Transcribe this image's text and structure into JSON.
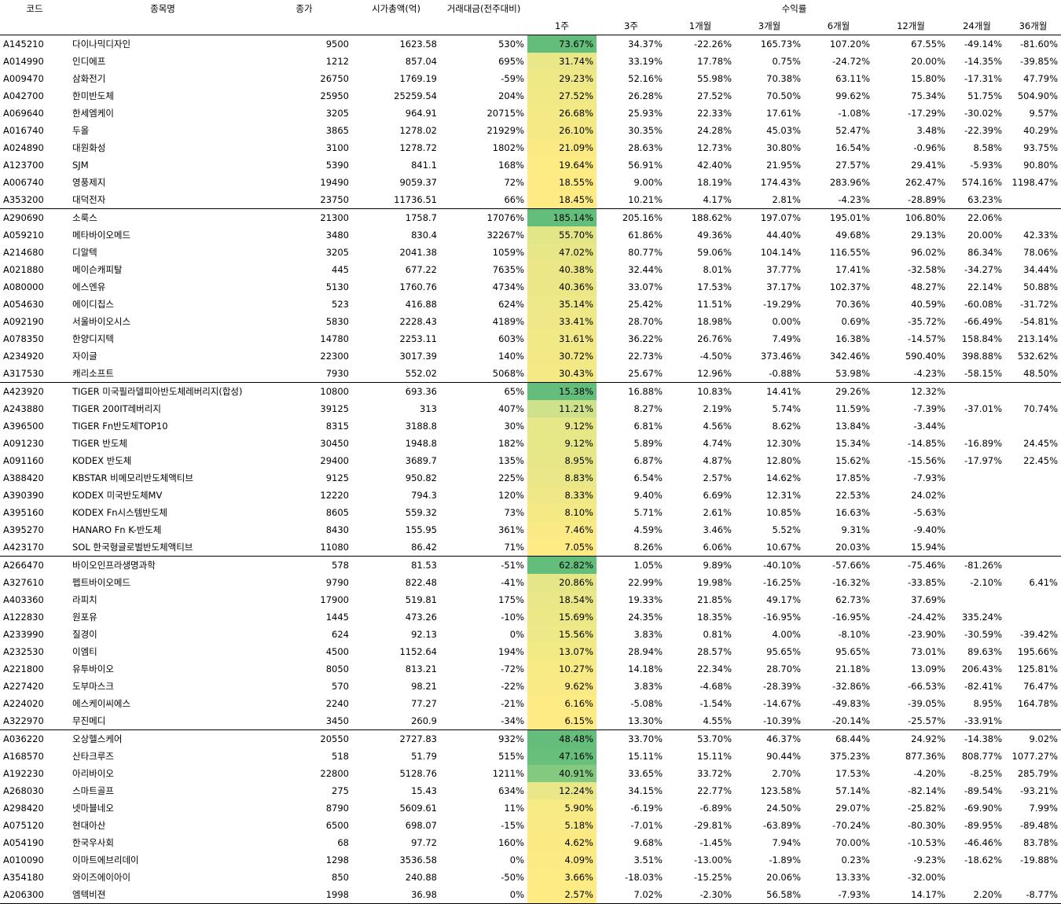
{
  "header": {
    "code": "코드",
    "name": "종목명",
    "close": "종가",
    "mcap": "시가총액(억)",
    "volume": "거래대금(전주대비)",
    "returns_group": "수익률",
    "periods": [
      "1주",
      "3주",
      "1개월",
      "3개월",
      "6개월",
      "12개월",
      "24개월",
      "36개월"
    ]
  },
  "colors": {
    "heat_high": "#63be7b",
    "heat_mid": "#cde28a",
    "heat_low": "#ffeb84"
  },
  "rows": [
    [
      "A145210",
      "다이나믹디자인",
      "9500",
      "1623.58",
      "530%",
      "73.67%",
      "34.37%",
      "-22.26%",
      "165.73%",
      "107.20%",
      "67.55%",
      "-49.14%",
      "-81.60%"
    ],
    [
      "A014990",
      "인디에프",
      "1212",
      "857.04",
      "695%",
      "31.74%",
      "33.19%",
      "17.78%",
      "0.75%",
      "-24.72%",
      "20.00%",
      "-14.35%",
      "-39.85%"
    ],
    [
      "A009470",
      "삼화전기",
      "26750",
      "1769.19",
      "-59%",
      "29.23%",
      "52.16%",
      "55.98%",
      "70.38%",
      "63.11%",
      "15.80%",
      "-17.31%",
      "47.79%"
    ],
    [
      "A042700",
      "한미반도체",
      "25950",
      "25259.54",
      "204%",
      "27.52%",
      "26.28%",
      "27.52%",
      "70.50%",
      "99.62%",
      "75.34%",
      "51.75%",
      "504.90%"
    ],
    [
      "A069640",
      "한세엠케이",
      "3205",
      "964.91",
      "20715%",
      "26.68%",
      "25.93%",
      "22.33%",
      "17.61%",
      "-1.08%",
      "-17.29%",
      "-30.02%",
      "9.57%"
    ],
    [
      "A016740",
      "두올",
      "3865",
      "1278.02",
      "21929%",
      "26.10%",
      "30.35%",
      "24.28%",
      "45.03%",
      "52.47%",
      "3.48%",
      "-22.39%",
      "40.29%"
    ],
    [
      "A024890",
      "대원화성",
      "3100",
      "1278.72",
      "1802%",
      "21.09%",
      "28.63%",
      "12.73%",
      "30.80%",
      "16.54%",
      "-0.96%",
      "8.58%",
      "93.75%"
    ],
    [
      "A123700",
      "SJM",
      "5390",
      "841.1",
      "168%",
      "19.64%",
      "56.91%",
      "42.40%",
      "21.95%",
      "27.57%",
      "29.41%",
      "-5.93%",
      "90.80%"
    ],
    [
      "A006740",
      "영풍제지",
      "19490",
      "9059.37",
      "72%",
      "18.55%",
      "9.00%",
      "18.19%",
      "174.43%",
      "283.96%",
      "262.47%",
      "574.16%",
      "1198.47%"
    ],
    [
      "A353200",
      "대덕전자",
      "23750",
      "11736.51",
      "66%",
      "18.45%",
      "10.21%",
      "4.17%",
      "2.81%",
      "-4.23%",
      "-28.89%",
      "63.23%",
      ""
    ],
    [
      "A290690",
      "소룩스",
      "21300",
      "1758.7",
      "17076%",
      "185.14%",
      "205.16%",
      "188.62%",
      "197.07%",
      "195.01%",
      "106.80%",
      "22.06%",
      ""
    ],
    [
      "A059210",
      "메타바이오메드",
      "3480",
      "830.4",
      "32267%",
      "55.70%",
      "61.86%",
      "49.36%",
      "44.40%",
      "49.68%",
      "29.13%",
      "20.00%",
      "42.33%"
    ],
    [
      "A214680",
      "디알텍",
      "3205",
      "2041.38",
      "1059%",
      "47.02%",
      "80.77%",
      "59.06%",
      "104.14%",
      "116.55%",
      "96.02%",
      "86.34%",
      "78.06%"
    ],
    [
      "A021880",
      "메이슨캐피탈",
      "445",
      "677.22",
      "7635%",
      "40.38%",
      "32.44%",
      "8.01%",
      "37.77%",
      "17.41%",
      "-32.58%",
      "-34.27%",
      "34.44%"
    ],
    [
      "A080000",
      "에스엔유",
      "5130",
      "1760.76",
      "4734%",
      "40.36%",
      "33.07%",
      "17.53%",
      "37.17%",
      "102.37%",
      "48.27%",
      "22.14%",
      "50.88%"
    ],
    [
      "A054630",
      "에이디칩스",
      "523",
      "416.88",
      "624%",
      "35.14%",
      "25.42%",
      "11.51%",
      "-19.29%",
      "70.36%",
      "40.59%",
      "-60.08%",
      "-31.72%"
    ],
    [
      "A092190",
      "서울바이오시스",
      "5830",
      "2228.43",
      "4189%",
      "33.41%",
      "28.70%",
      "18.98%",
      "0.00%",
      "0.69%",
      "-35.72%",
      "-66.49%",
      "-54.81%"
    ],
    [
      "A078350",
      "한양디지텍",
      "14780",
      "2253.11",
      "603%",
      "31.61%",
      "36.22%",
      "26.76%",
      "7.49%",
      "16.38%",
      "-14.57%",
      "158.84%",
      "213.14%"
    ],
    [
      "A234920",
      "자이글",
      "22300",
      "3017.39",
      "140%",
      "30.72%",
      "22.73%",
      "-4.50%",
      "373.46%",
      "342.46%",
      "590.40%",
      "398.88%",
      "532.62%"
    ],
    [
      "A317530",
      "캐리소프트",
      "7930",
      "552.02",
      "5068%",
      "30.43%",
      "25.67%",
      "12.96%",
      "-0.88%",
      "53.98%",
      "-4.23%",
      "-58.15%",
      "48.50%"
    ],
    [
      "A423920",
      "TIGER 미국필라델피아반도체레버리지(합성)",
      "10800",
      "693.36",
      "65%",
      "15.38%",
      "16.88%",
      "10.83%",
      "14.41%",
      "29.26%",
      "12.32%",
      "",
      ""
    ],
    [
      "A243880",
      "TIGER 200IT레버리지",
      "39125",
      "313",
      "407%",
      "11.21%",
      "8.27%",
      "2.19%",
      "5.74%",
      "11.59%",
      "-7.39%",
      "-37.01%",
      "70.74%"
    ],
    [
      "A396500",
      "TIGER Fn반도체TOP10",
      "8315",
      "3188.8",
      "30%",
      "9.12%",
      "6.81%",
      "4.56%",
      "8.62%",
      "13.84%",
      "-3.44%",
      "",
      ""
    ],
    [
      "A091230",
      "TIGER 반도체",
      "30450",
      "1948.8",
      "182%",
      "9.12%",
      "5.89%",
      "4.74%",
      "12.30%",
      "15.34%",
      "-14.85%",
      "-16.89%",
      "24.45%"
    ],
    [
      "A091160",
      "KODEX 반도체",
      "29400",
      "3689.7",
      "135%",
      "8.95%",
      "6.87%",
      "4.87%",
      "12.80%",
      "15.62%",
      "-15.56%",
      "-17.97%",
      "22.45%"
    ],
    [
      "A388420",
      "KBSTAR 비메모리반도체액티브",
      "9125",
      "950.82",
      "225%",
      "8.83%",
      "6.54%",
      "2.57%",
      "14.62%",
      "17.85%",
      "-7.93%",
      "",
      ""
    ],
    [
      "A390390",
      "KODEX 미국반도체MV",
      "12220",
      "794.3",
      "120%",
      "8.33%",
      "9.40%",
      "6.69%",
      "12.31%",
      "22.53%",
      "24.02%",
      "",
      ""
    ],
    [
      "A395160",
      "KODEX Fn시스템반도체",
      "8605",
      "559.32",
      "73%",
      "8.10%",
      "5.71%",
      "2.61%",
      "10.85%",
      "16.63%",
      "-5.63%",
      "",
      ""
    ],
    [
      "A395270",
      "HANARO Fn K-반도체",
      "8430",
      "155.95",
      "361%",
      "7.46%",
      "4.59%",
      "3.46%",
      "5.52%",
      "9.31%",
      "-9.40%",
      "",
      ""
    ],
    [
      "A423170",
      "SOL 한국형글로벌반도체액티브",
      "11080",
      "86.42",
      "71%",
      "7.05%",
      "8.26%",
      "6.06%",
      "10.67%",
      "20.03%",
      "15.94%",
      "",
      ""
    ],
    [
      "A266470",
      "바이오인프라생명과학",
      "578",
      "81.53",
      "-51%",
      "62.82%",
      "1.05%",
      "9.89%",
      "-40.10%",
      "-57.66%",
      "-75.46%",
      "-81.26%",
      ""
    ],
    [
      "A327610",
      "펩트바이오메드",
      "9790",
      "822.48",
      "-41%",
      "20.86%",
      "22.99%",
      "19.98%",
      "-16.25%",
      "-16.32%",
      "-33.85%",
      "-2.10%",
      "6.41%"
    ],
    [
      "A403360",
      "라피치",
      "17900",
      "519.81",
      "175%",
      "18.54%",
      "19.33%",
      "21.85%",
      "49.17%",
      "62.73%",
      "37.69%",
      "",
      ""
    ],
    [
      "A122830",
      "원포유",
      "1445",
      "473.26",
      "-10%",
      "15.69%",
      "24.35%",
      "18.35%",
      "-16.95%",
      "-16.95%",
      "-24.42%",
      "335.24%",
      ""
    ],
    [
      "A233990",
      "질경이",
      "624",
      "92.13",
      "0%",
      "15.56%",
      "3.83%",
      "0.81%",
      "4.00%",
      "-8.10%",
      "-23.90%",
      "-30.59%",
      "-39.42%"
    ],
    [
      "A232530",
      "이엠티",
      "4500",
      "1152.64",
      "194%",
      "13.07%",
      "28.94%",
      "28.57%",
      "95.65%",
      "95.65%",
      "73.01%",
      "89.63%",
      "195.66%"
    ],
    [
      "A221800",
      "유투바이오",
      "8050",
      "813.21",
      "-72%",
      "10.27%",
      "14.18%",
      "22.34%",
      "28.70%",
      "21.18%",
      "13.09%",
      "206.43%",
      "125.81%"
    ],
    [
      "A227420",
      "도부마스크",
      "570",
      "98.21",
      "-22%",
      "9.62%",
      "3.83%",
      "-4.68%",
      "-28.39%",
      "-32.86%",
      "-66.53%",
      "-82.41%",
      "76.47%"
    ],
    [
      "A224020",
      "에스케이씨에스",
      "2240",
      "77.27",
      "-21%",
      "6.16%",
      "-5.08%",
      "-1.54%",
      "-14.67%",
      "-49.83%",
      "-39.05%",
      "8.95%",
      "164.78%"
    ],
    [
      "A322970",
      "무진메디",
      "3450",
      "260.9",
      "-34%",
      "6.15%",
      "13.30%",
      "4.55%",
      "-10.39%",
      "-20.14%",
      "-25.57%",
      "-33.91%",
      ""
    ],
    [
      "A036220",
      "오상헬스케어",
      "20550",
      "2727.83",
      "932%",
      "48.48%",
      "33.70%",
      "53.70%",
      "46.37%",
      "68.44%",
      "24.92%",
      "-14.38%",
      "9.02%"
    ],
    [
      "A168570",
      "산타크루즈",
      "518",
      "51.79",
      "515%",
      "47.16%",
      "15.11%",
      "15.11%",
      "90.44%",
      "375.23%",
      "877.36%",
      "808.77%",
      "1077.27%"
    ],
    [
      "A192230",
      "아리바이오",
      "22800",
      "5128.76",
      "1211%",
      "40.91%",
      "33.65%",
      "33.72%",
      "2.70%",
      "17.53%",
      "-4.20%",
      "-8.25%",
      "285.79%"
    ],
    [
      "A268030",
      "스마트골프",
      "275",
      "15.43",
      "634%",
      "12.24%",
      "34.15%",
      "22.77%",
      "123.58%",
      "57.14%",
      "-82.14%",
      "-89.54%",
      "-93.21%"
    ],
    [
      "A298420",
      "넷마블네오",
      "8790",
      "5609.61",
      "11%",
      "5.90%",
      "-6.19%",
      "-6.89%",
      "24.50%",
      "29.07%",
      "-25.82%",
      "-69.90%",
      "7.99%"
    ],
    [
      "A075120",
      "현대아산",
      "6500",
      "698.07",
      "-15%",
      "5.18%",
      "-7.01%",
      "-29.81%",
      "-63.89%",
      "-70.24%",
      "-80.30%",
      "-89.95%",
      "-89.48%"
    ],
    [
      "A054190",
      "한국우사회",
      "68",
      "97.72",
      "160%",
      "4.62%",
      "9.68%",
      "-1.45%",
      "7.94%",
      "70.00%",
      "-10.53%",
      "-46.46%",
      "83.78%"
    ],
    [
      "A010090",
      "이마트에브리데이",
      "1298",
      "3536.58",
      "0%",
      "4.09%",
      "3.51%",
      "-13.00%",
      "-1.89%",
      "0.23%",
      "-9.23%",
      "-18.62%",
      "-19.88%"
    ],
    [
      "A354180",
      "와이즈에이아이",
      "850",
      "240.88",
      "-50%",
      "3.66%",
      "-18.03%",
      "-15.25%",
      "20.06%",
      "13.33%",
      "-32.00%",
      "",
      ""
    ],
    [
      "A206300",
      "엠텍비젼",
      "1998",
      "36.98",
      "0%",
      "2.57%",
      "7.02%",
      "-2.30%",
      "56.58%",
      "-7.93%",
      "14.17%",
      "2.20%",
      "-8.77%"
    ]
  ],
  "week_heat": [
    1.0,
    0.22,
    0.17,
    0.14,
    0.12,
    0.11,
    0.04,
    0.02,
    0.01,
    0.0,
    1.0,
    0.29,
    0.24,
    0.2,
    0.2,
    0.17,
    0.15,
    0.14,
    0.13,
    0.12,
    1.0,
    0.5,
    0.25,
    0.25,
    0.23,
    0.22,
    0.15,
    0.12,
    0.05,
    0.0,
    1.0,
    0.26,
    0.22,
    0.18,
    0.17,
    0.12,
    0.07,
    0.05,
    0.0,
    0.0,
    1.0,
    0.98,
    0.85,
    0.22,
    0.07,
    0.05,
    0.04,
    0.03,
    0.02,
    0.0
  ]
}
